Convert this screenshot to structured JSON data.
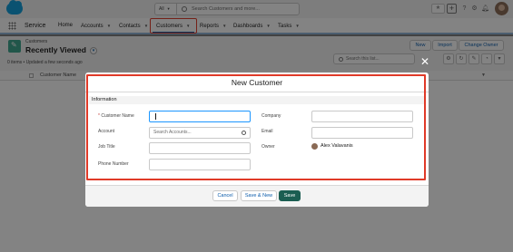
{
  "topbar": {
    "search_scope": "All",
    "search_placeholder": "Search Customers and more..."
  },
  "nav": {
    "app_name": "Service",
    "items": [
      {
        "label": "Home",
        "has_menu": false
      },
      {
        "label": "Accounts",
        "has_menu": true
      },
      {
        "label": "Contacts",
        "has_menu": true
      },
      {
        "label": "Customers",
        "has_menu": true,
        "active": true
      },
      {
        "label": "Reports",
        "has_menu": true
      },
      {
        "label": "Dashboards",
        "has_menu": true
      },
      {
        "label": "Tasks",
        "has_menu": true
      }
    ]
  },
  "list": {
    "object_name": "Customers",
    "view_name": "Recently Viewed",
    "meta": "0 items • Updated a few seconds ago",
    "buttons": {
      "new": "New",
      "import": "Import",
      "change_owner": "Change Owner"
    },
    "search_placeholder": "Search this list...",
    "column_header": "Customer Name"
  },
  "modal": {
    "title": "New Customer",
    "section": "Information",
    "fields": {
      "customer_name_label": "Customer Name",
      "customer_name_required": "*",
      "account_label": "Account",
      "account_placeholder": "Search Accounts...",
      "job_title_label": "Job Title",
      "phone_label": "Phone Number",
      "company_label": "Company",
      "email_label": "Email",
      "owner_label": "Owner",
      "owner_value": "Alex Valavanis"
    },
    "buttons": {
      "cancel": "Cancel",
      "save_new": "Save & New",
      "save": "Save"
    },
    "close_glyph": "✕"
  },
  "colors": {
    "highlight": "#e03a28",
    "save_button": "#1b5e52",
    "focus": "#1b96ff",
    "brand_logo": "#0d9dda"
  },
  "icons": [
    "salesforce-logo-icon",
    "app-launcher-icon",
    "search-icon",
    "favorites-icon",
    "add-icon",
    "help-icon",
    "setup-gear-icon",
    "notifications-bell-icon",
    "close-icon",
    "pin-icon",
    "chevron-down-icon"
  ]
}
